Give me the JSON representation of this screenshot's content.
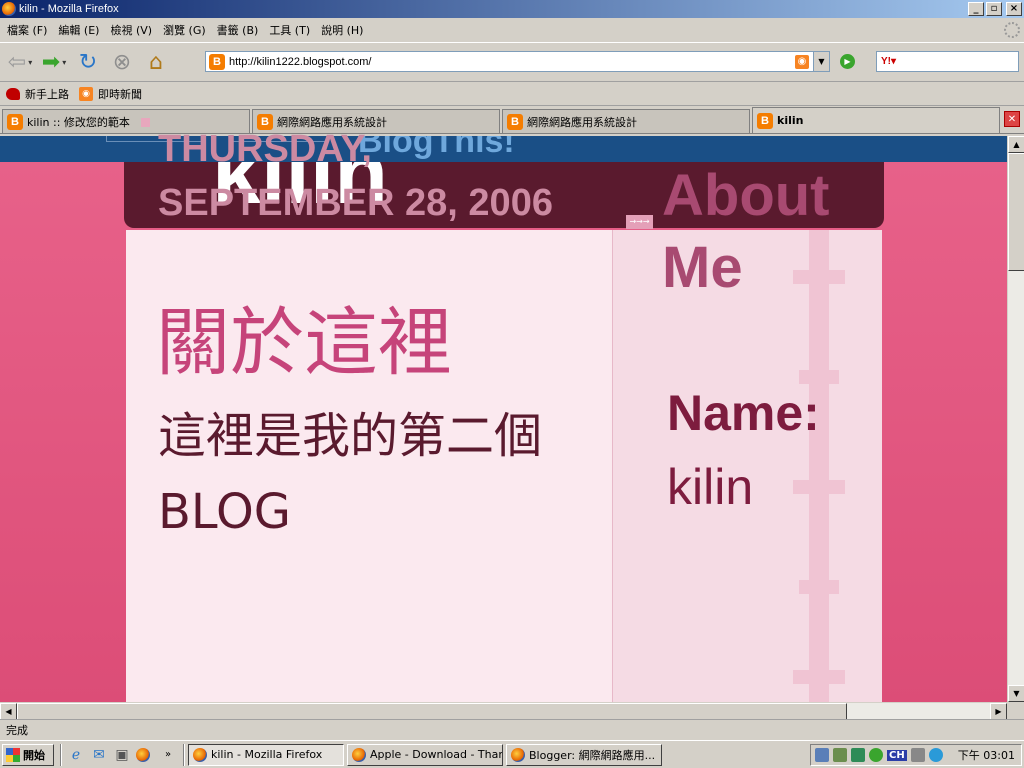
{
  "window": {
    "title": "kilin - Mozilla Firefox",
    "buttons": [
      "_",
      "▫",
      "×"
    ]
  },
  "menu": [
    "檔案 (F)",
    "編輯 (E)",
    "檢視 (V)",
    "瀏覽 (G)",
    "書籤 (B)",
    "工具 (T)",
    "說明 (H)"
  ],
  "toolbar": {
    "url": "http://kilin1222.blogspot.com/"
  },
  "bookmarks": [
    {
      "label": "新手上路",
      "icon": "firefox-help-icon"
    },
    {
      "label": "即時新聞",
      "icon": "rss-feed-icon"
    }
  ],
  "tabs": [
    {
      "label": "kilin :: 修改您的範本",
      "active": false
    },
    {
      "label": "網際網路應用系統設計",
      "active": false
    },
    {
      "label": "網際網路應用系統設計",
      "active": false
    },
    {
      "label": "kilin",
      "active": true
    }
  ],
  "page": {
    "blogger_nav_text": "BlogThis!",
    "blog_title": "kilin",
    "date_header": "THURSDAY, SEPTEMBER 28, 2006",
    "post_title": "關於這裡",
    "post_body": "這裡是我的第二個BLOG",
    "sidebar": {
      "about_heading": "About Me",
      "name_label": "Name:",
      "name_value": "kilin"
    }
  },
  "status": "完成",
  "taskbar": {
    "start_label": "開始",
    "tasks": [
      {
        "label": "kilin - Mozilla Firefox",
        "active": true
      },
      {
        "label": "Apple - Download - Thank...",
        "active": false
      },
      {
        "label": "Blogger: 網際網路應用...",
        "active": false
      }
    ],
    "tray_ime": "CH",
    "clock": "下午 03:01"
  },
  "colors": {
    "page_bg": "#e8628a",
    "header_band": "#5a1a2e",
    "post_title": "#c6447a",
    "date_header": "#cc8aa2"
  }
}
